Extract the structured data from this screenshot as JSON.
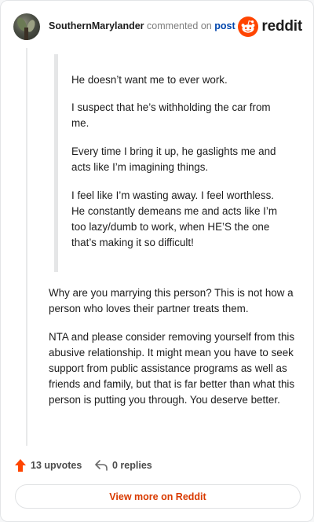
{
  "header": {
    "username": "SouthernMarylander",
    "action_text": "commented on",
    "post_link": "post",
    "brand_name": "reddit"
  },
  "quote": {
    "paragraphs": [
      "He doesn’t want me to ever work.",
      "I suspect that he’s withholding the car from me.",
      "Every time I bring it up, he gaslights me and acts like I’m imagining things.",
      "I feel like I’m wasting away. I feel worthless. He constantly demeans me and acts like I’m too lazy/dumb to work, when HE’S the one that’s making it so difficult!"
    ]
  },
  "comment": {
    "paragraphs": [
      "Why are you marrying this person? This is not how a person who loves their partner treats them.",
      "NTA and please consider removing yourself from this abusive relationship. It might mean you have to seek support from public assistance programs as well as friends and family, but that is far better than what this person is putting you through. You deserve better."
    ]
  },
  "actions": {
    "upvotes": "13 upvotes",
    "replies": "0 replies"
  },
  "view_more": "View more on Reddit",
  "colors": {
    "brand": "#ff4500",
    "link": "#0045ac",
    "cta": "#d93a00"
  },
  "icons": [
    "avatar",
    "reddit-logo-icon",
    "upvote-arrow-icon",
    "reply-icon"
  ]
}
